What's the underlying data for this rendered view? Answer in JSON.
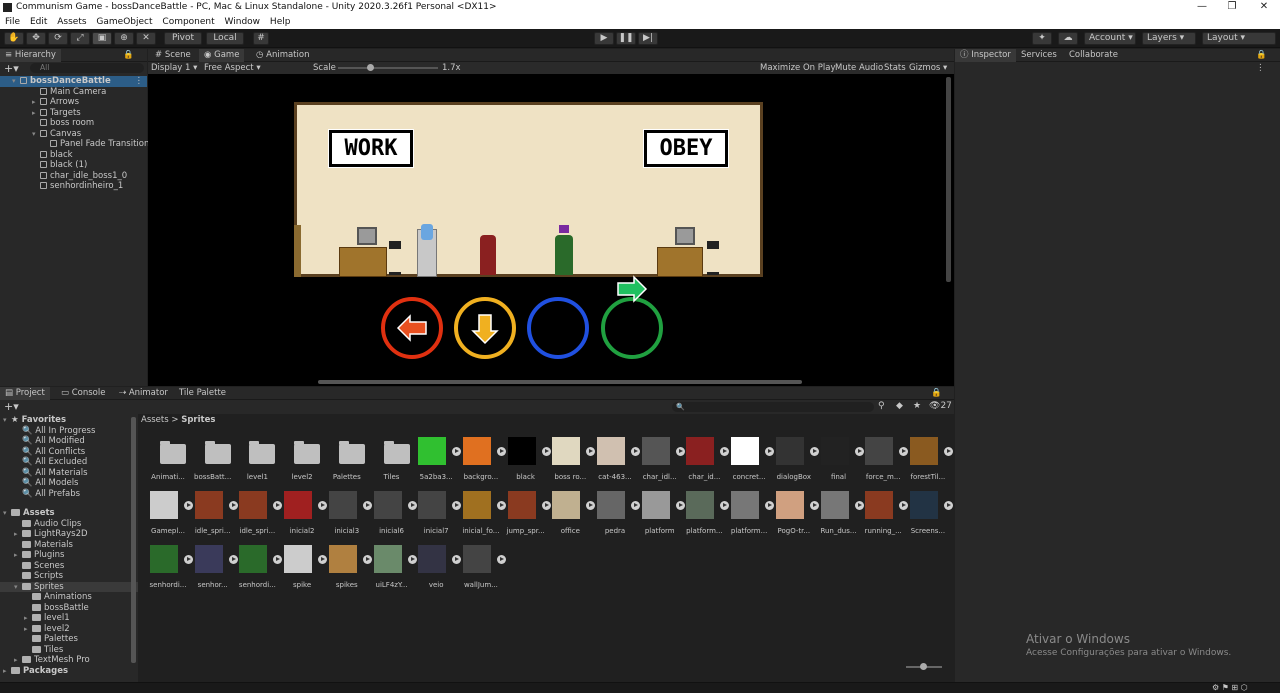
{
  "window": {
    "title": "Communism Game - bossDanceBattle - PC, Mac & Linux Standalone - Unity 2020.3.26f1 Personal <DX11>",
    "minimize": "—",
    "maximize": "❐",
    "close": "✕"
  },
  "menu": [
    "File",
    "Edit",
    "Assets",
    "GameObject",
    "Component",
    "Window",
    "Help"
  ],
  "toolbar": {
    "pivot": "Pivot",
    "local": "Local",
    "account": "Account",
    "layers": "Layers",
    "layout": "Layout"
  },
  "hierarchy": {
    "tab": "Hierarchy",
    "search_placeholder": "All",
    "scene": "bossDanceBattle",
    "items": [
      "Main Camera",
      "Arrows",
      "Targets",
      "boss room",
      "Canvas",
      "Panel Fade Transition",
      "black",
      "black (1)",
      "char_idle_boss1_0",
      "senhordinheiro_1"
    ]
  },
  "scene_tabs": [
    "Scene",
    "Game",
    "Animation"
  ],
  "game_bar": {
    "display": "Display 1",
    "aspect": "Free Aspect",
    "scale_label": "Scale",
    "scale_value": "1.7x",
    "maximize": "Maximize On Play",
    "mute": "Mute Audio",
    "stats": "Stats",
    "gizmos": "Gizmos"
  },
  "game": {
    "sign_left": "WORK",
    "sign_right": "OBEY",
    "arrows": [
      {
        "dir": "left",
        "color": "#e03010",
        "filled": true
      },
      {
        "dir": "down",
        "color": "#f0b020",
        "filled": true
      },
      {
        "dir": "up",
        "color": "#2050e0",
        "filled": false
      },
      {
        "dir": "right",
        "color": "#20a040",
        "filled": false
      }
    ]
  },
  "inspector_tabs": [
    "Inspector",
    "Services",
    "Collaborate"
  ],
  "bottom_tabs": [
    "Project",
    "Console",
    "Animator",
    "Tile Palette"
  ],
  "project": {
    "favorites_label": "Favorites",
    "favorites": [
      "All In Progress",
      "All Modified",
      "All Conflicts",
      "All Excluded",
      "All Materials",
      "All Models",
      "All Prefabs"
    ],
    "assets_label": "Assets",
    "assets_tree": [
      "Audio Clips",
      "LightRays2D",
      "Materials",
      "Plugins",
      "Scenes",
      "Scripts",
      "Sprites",
      "Animations",
      "bossBattle",
      "level1",
      "level2",
      "Palettes",
      "Tiles",
      "TextMesh Pro"
    ],
    "packages_label": "Packages",
    "breadcrumb": [
      "Assets",
      "Sprites"
    ],
    "count": "27",
    "grid": [
      "Animati...",
      "bossBatt...",
      "level1",
      "level2",
      "Palettes",
      "Tiles",
      "5a2ba3...",
      "backgro...",
      "black",
      "boss ro...",
      "cat-463...",
      "char_idl...",
      "char_id...",
      "concret...",
      "dialogBox",
      "final",
      "force_m...",
      "forestTil...",
      "Gamepl...",
      "idle_spri...",
      "idle_spri...",
      "inicial2",
      "inicial3",
      "inicial6",
      "inicial7",
      "inicial_fo...",
      "jump_spr...",
      "office",
      "pedra",
      "platform",
      "platform...",
      "platform...",
      "PogO-tr...",
      "Run_dus...",
      "running_...",
      "Screens...",
      "senhordi...",
      "senhor...",
      "senhordi...",
      "spike",
      "spikes",
      "uiLF4zY...",
      "veio",
      "wallJum..."
    ]
  },
  "watermark": {
    "line1": "Ativar o Windows",
    "line2": "Acesse Configurações para ativar o Windows."
  }
}
